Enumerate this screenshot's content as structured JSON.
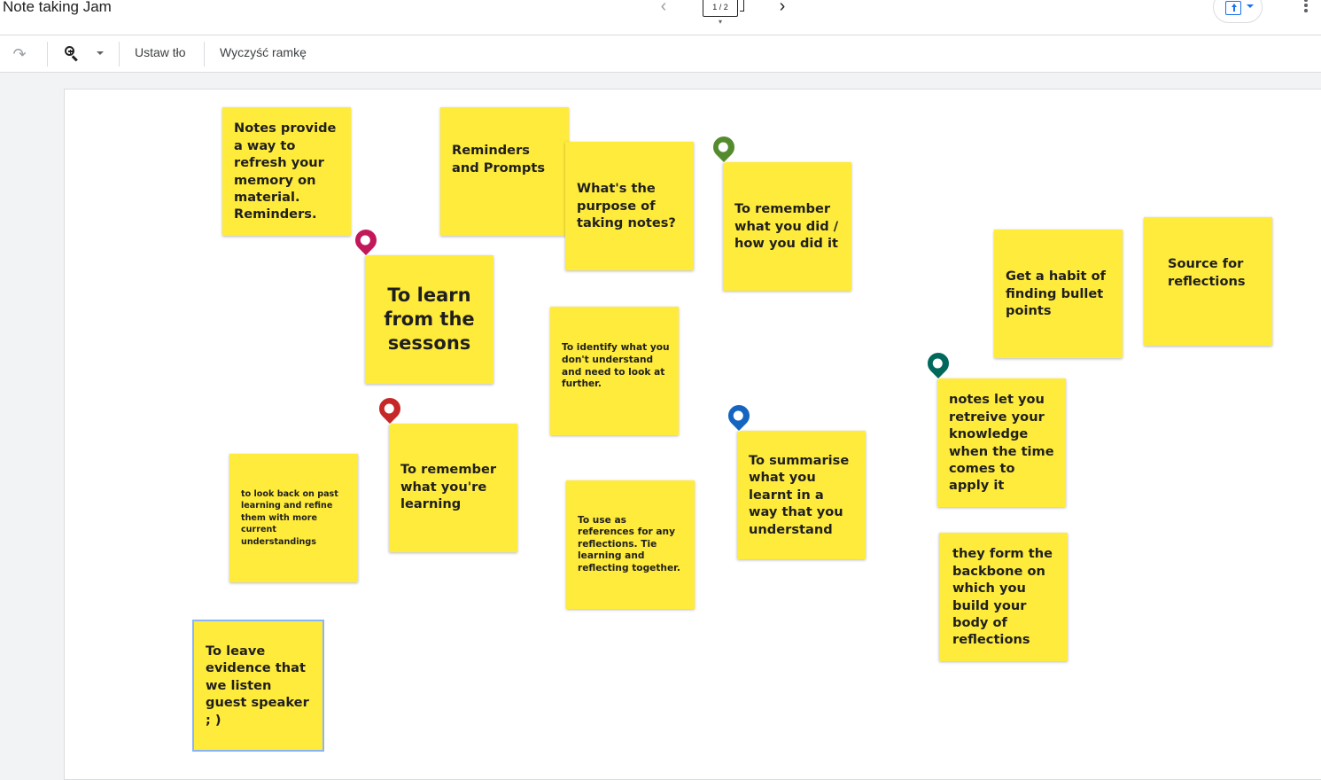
{
  "header": {
    "title": "Note taking Jam",
    "frame_counter": "1 / 2",
    "prev_icon": "chevron-left-icon",
    "next_icon": "chevron-right-icon",
    "share_icon": "upload-share-icon",
    "more_icon": "more-vert-icon"
  },
  "toolbar": {
    "redo_icon": "redo-icon",
    "zoom_icon": "zoom-in-icon",
    "set_background": "Ustaw tło",
    "clear_frame": "Wyczyść ramkę"
  },
  "colors": {
    "note": "#ffeb3b",
    "accent": "#1a73e8",
    "selection": "#8ab4f8"
  },
  "notes": [
    {
      "text": "Notes provide a way to refresh your memory on material. Reminders."
    },
    {
      "text": "Reminders and Prompts"
    },
    {
      "text": "What's the purpose of taking notes?"
    },
    {
      "text": "To remember what you did / how you did it"
    },
    {
      "text": "To learn from the sessons"
    },
    {
      "text": "To identify what you don't understand and need to look at further."
    },
    {
      "text": "Get a habit of finding bullet points"
    },
    {
      "text": "Source for reflections"
    },
    {
      "text": "notes let you retreive your knowledge when the time comes to apply it"
    },
    {
      "text": "to look back on past learning and refine them with more current understandings"
    },
    {
      "text": "To remember what you're learning"
    },
    {
      "text": "To use as references for any reflections. Tie learning and reflecting together."
    },
    {
      "text": "To summarise what you learnt in a way that you understand"
    },
    {
      "text": "they form the backbone on which you build your body of reflections"
    },
    {
      "text": "To leave evidence that we listen guest speaker ; )"
    }
  ],
  "collaborators": [
    {
      "icon": "bear-avatar-icon",
      "color": "#c2185b"
    },
    {
      "icon": "squirrel-avatar-icon",
      "color": "#558b2f"
    },
    {
      "icon": "fox-avatar-icon",
      "color": "#c62828"
    },
    {
      "icon": "dolphin-avatar-icon",
      "color": "#1565c0"
    },
    {
      "icon": "axolotl-avatar-icon",
      "color": "#00695c"
    }
  ]
}
